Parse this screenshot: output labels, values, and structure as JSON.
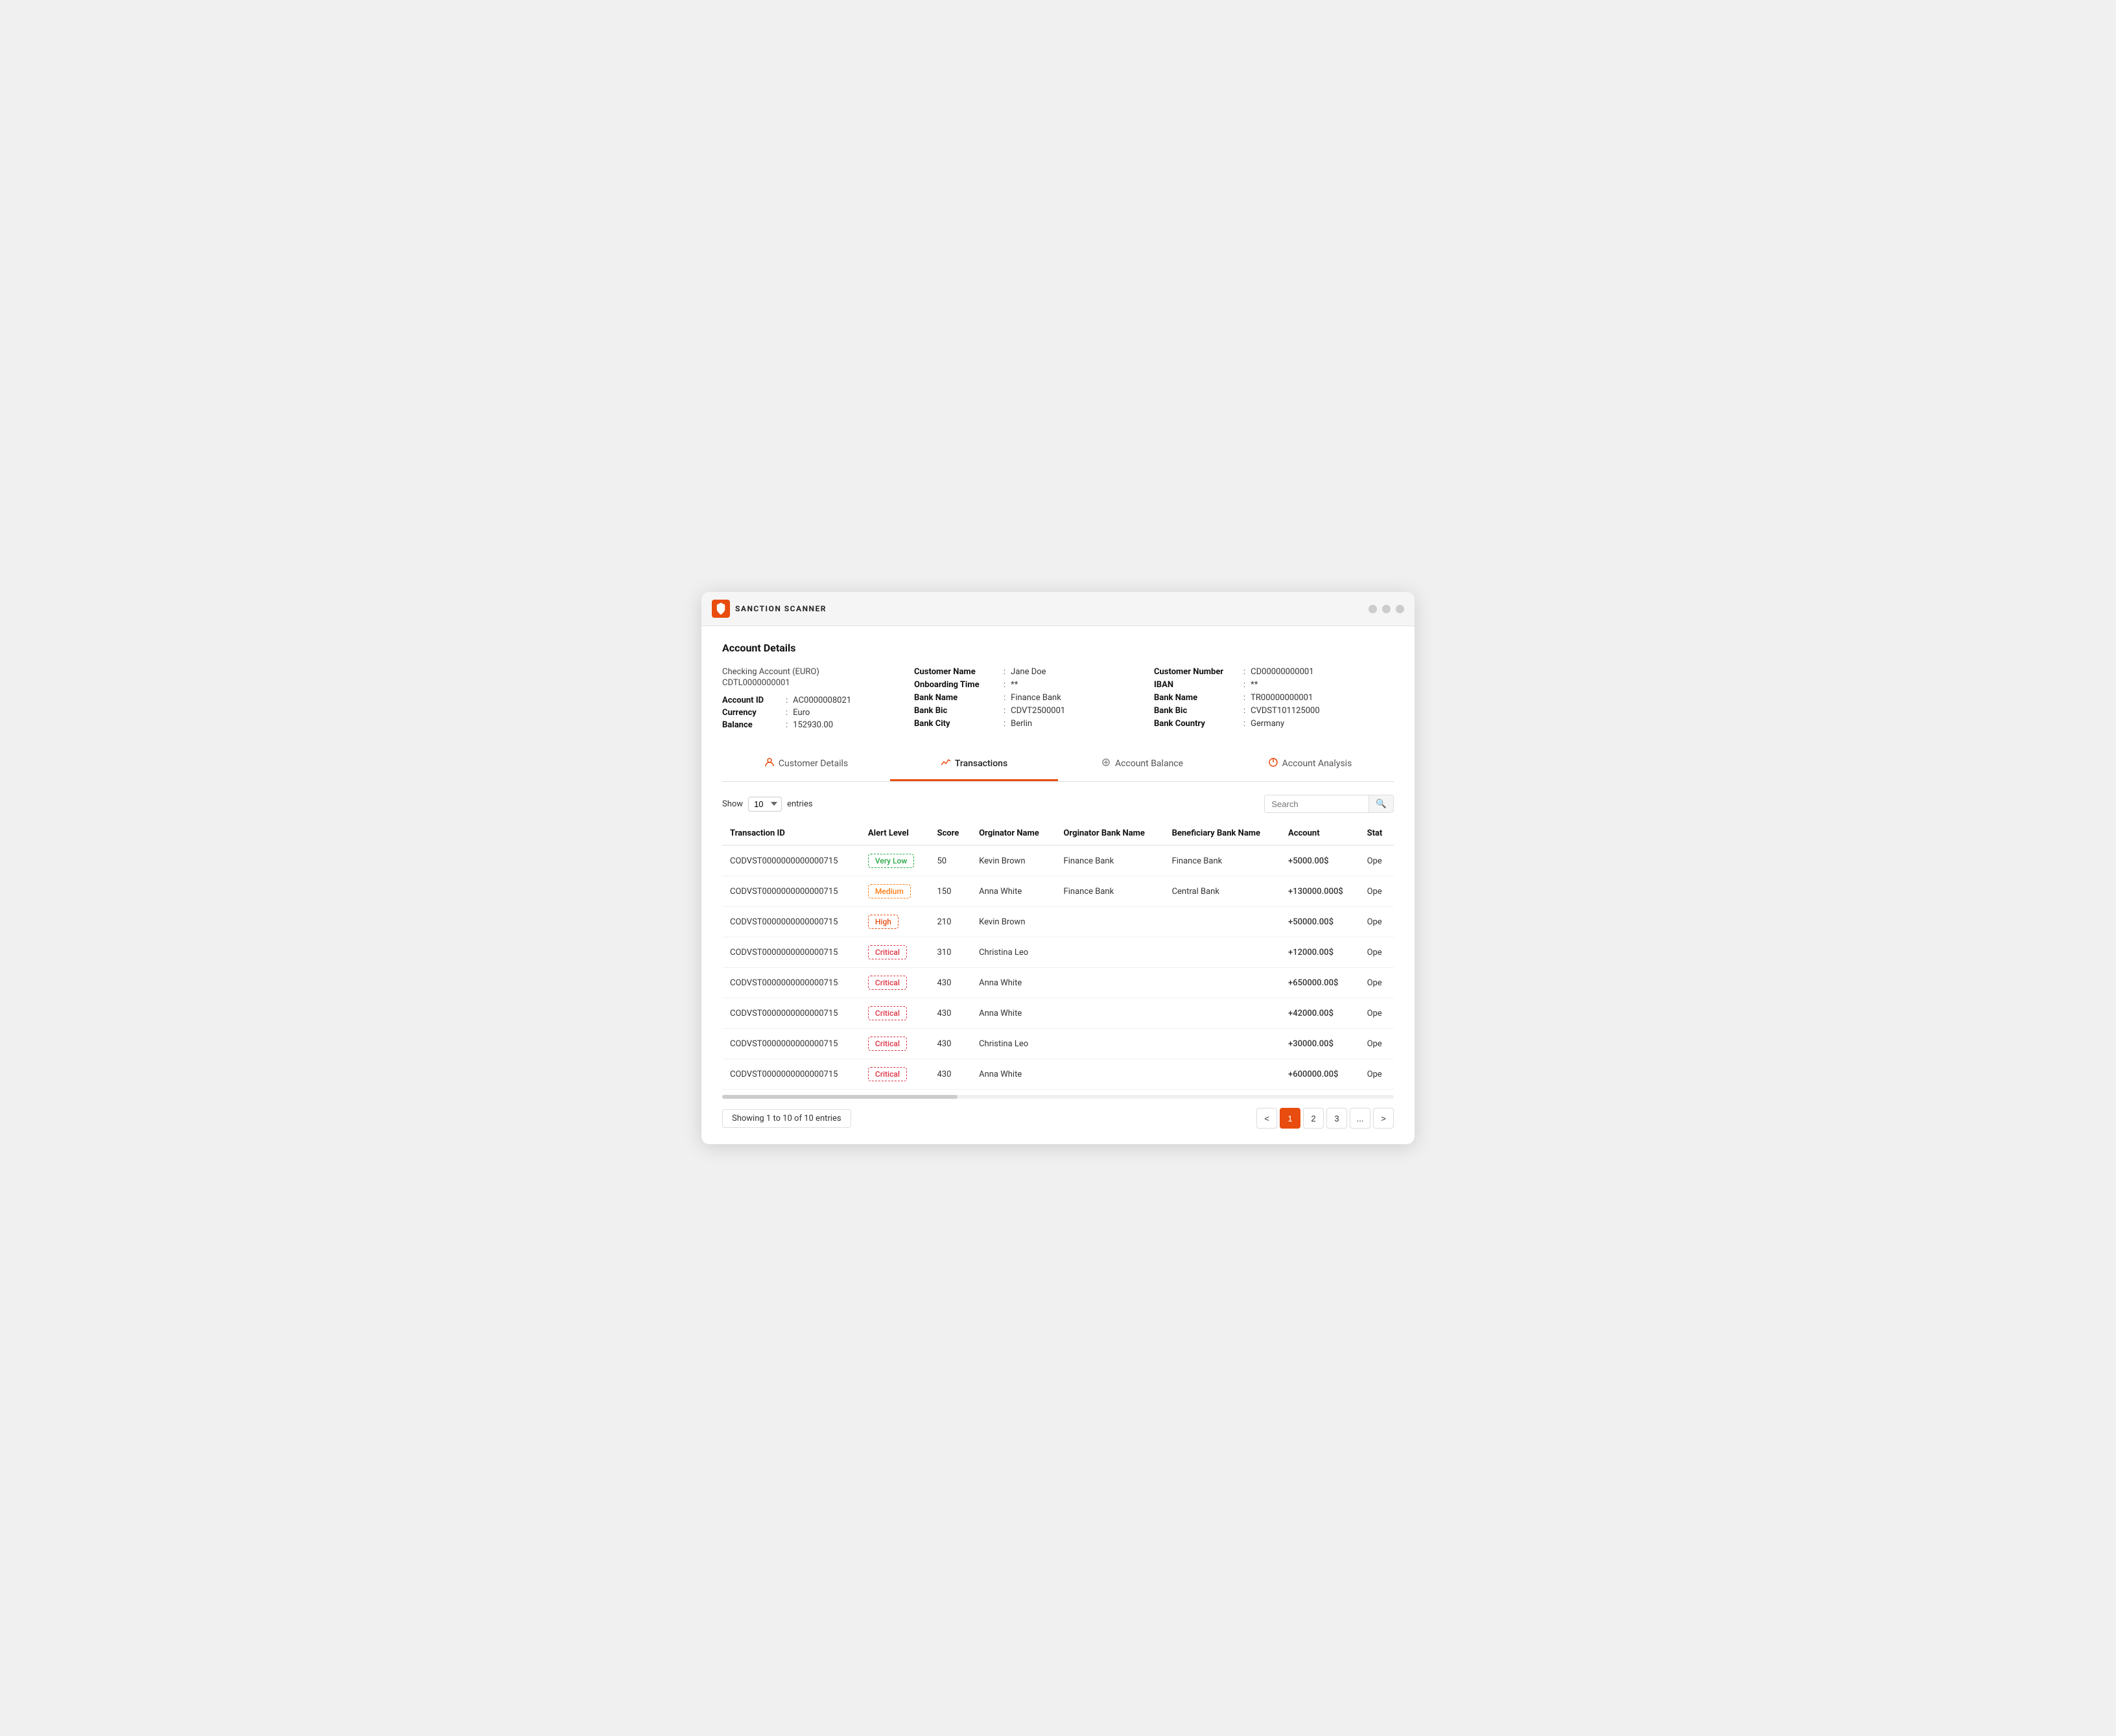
{
  "app": {
    "logo_text": "SANCTION SCANNER",
    "title": "Account Details"
  },
  "account": {
    "type": "Checking Account (EURO)",
    "id_top": "CDTL0000000001",
    "fields": [
      {
        "label": "Account ID",
        "colon": ":",
        "value": "AC0000008021"
      },
      {
        "label": "Currency",
        "colon": ":",
        "value": "Euro"
      },
      {
        "label": "Balance",
        "colon": ":",
        "value": "152930.00"
      }
    ]
  },
  "customer_details": {
    "left": [
      {
        "label": "Customer Name",
        "colon": ":",
        "value": "Jane Doe"
      },
      {
        "label": "Onboarding Time",
        "colon": ":",
        "value": "**"
      },
      {
        "label": "Bank Name",
        "colon": ":",
        "value": "Finance Bank"
      },
      {
        "label": "Bank Bic",
        "colon": ":",
        "value": "CDVT2500001"
      },
      {
        "label": "Bank City",
        "colon": ":",
        "value": "Berlin"
      }
    ],
    "right": [
      {
        "label": "Customer Number",
        "colon": ":",
        "value": "CD00000000001"
      },
      {
        "label": "IBAN",
        "colon": ":",
        "value": "**"
      },
      {
        "label": "Bank Name",
        "colon": ":",
        "value": "TR00000000001"
      },
      {
        "label": "Bank Bic",
        "colon": ":",
        "value": "CVDST101125000"
      },
      {
        "label": "Bank Country",
        "colon": ":",
        "value": "Germany"
      }
    ]
  },
  "tabs": [
    {
      "id": "customer-details",
      "label": "Customer Details",
      "icon": "👤"
    },
    {
      "id": "transactions",
      "label": "Transactions",
      "icon": "📈",
      "active": true
    },
    {
      "id": "account-balance",
      "label": "Account Balance",
      "icon": "⚙️"
    },
    {
      "id": "account-analysis",
      "label": "Account Analysis",
      "icon": "📊"
    }
  ],
  "table_controls": {
    "show_label": "Show",
    "entries_value": "10",
    "entries_label": "entries",
    "search_placeholder": "Search"
  },
  "table": {
    "columns": [
      "Transaction ID",
      "Alert Level",
      "Score",
      "Orginator Name",
      "Orginator Bank Name",
      "Beneficiary Bank Name",
      "Account",
      "Stat"
    ],
    "rows": [
      {
        "id": "CODVST0000000000000715",
        "alert": "Very Low",
        "alert_type": "very-low",
        "score": "50",
        "originator": "Kevin Brown",
        "orig_bank": "Finance Bank",
        "benef_bank": "Finance Bank",
        "account": "+5000.00$",
        "status": "Ope"
      },
      {
        "id": "CODVST0000000000000715",
        "alert": "Medium",
        "alert_type": "medium",
        "score": "150",
        "originator": "Anna White",
        "orig_bank": "Finance Bank",
        "benef_bank": "Central Bank",
        "account": "+130000.000$",
        "status": "Ope"
      },
      {
        "id": "CODVST0000000000000715",
        "alert": "High",
        "alert_type": "high",
        "score": "210",
        "originator": "Kevin Brown",
        "orig_bank": "",
        "benef_bank": "",
        "account": "+50000.00$",
        "status": "Ope"
      },
      {
        "id": "CODVST0000000000000715",
        "alert": "Critical",
        "alert_type": "critical",
        "score": "310",
        "originator": "Christina Leo",
        "orig_bank": "",
        "benef_bank": "",
        "account": "+12000.00$",
        "status": "Ope"
      },
      {
        "id": "CODVST0000000000000715",
        "alert": "Critical",
        "alert_type": "critical",
        "score": "430",
        "originator": "Anna White",
        "orig_bank": "",
        "benef_bank": "",
        "account": "+650000.00$",
        "status": "Ope"
      },
      {
        "id": "CODVST0000000000000715",
        "alert": "Critical",
        "alert_type": "critical",
        "score": "430",
        "originator": "Anna White",
        "orig_bank": "",
        "benef_bank": "",
        "account": "+42000.00$",
        "status": "Ope"
      },
      {
        "id": "CODVST0000000000000715",
        "alert": "Critical",
        "alert_type": "critical",
        "score": "430",
        "originator": "Christina Leo",
        "orig_bank": "",
        "benef_bank": "",
        "account": "+30000.00$",
        "status": "Ope"
      },
      {
        "id": "CODVST0000000000000715",
        "alert": "Critical",
        "alert_type": "critical",
        "score": "430",
        "originator": "Anna White",
        "orig_bank": "",
        "benef_bank": "",
        "account": "+600000.00$",
        "status": "Ope"
      }
    ]
  },
  "pagination": {
    "showing": "Showing 1 to 10 of 10 entries",
    "pages": [
      "1",
      "2",
      "3",
      "..."
    ],
    "prev": "<",
    "next": ">"
  }
}
